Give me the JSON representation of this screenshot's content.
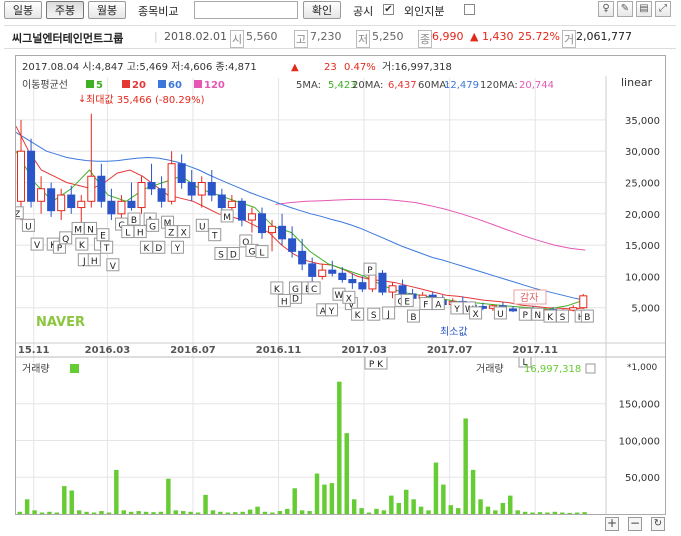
{
  "toolbar": {
    "tabs": [
      "일봉",
      "주봉",
      "월봉"
    ],
    "compare_label": "종목비교",
    "compare_value": "",
    "confirm_label": "확인",
    "disclosure_label": "공시",
    "disclosure_checked": "✔",
    "foreign_label": "외인지분"
  },
  "info": {
    "name": "씨그널엔터테인먼트그룹",
    "date": "2018.02.01",
    "open_badge": "시",
    "open": "5,560",
    "high_badge": "고",
    "high": "7,230",
    "low_badge": "저",
    "low": "5,250",
    "close_badge": "종",
    "close": "6,990",
    "change": "▲ 1,430",
    "change_pct": "25.72%",
    "volume_badge": "거",
    "volume": "2,061,777"
  },
  "chart_data": {
    "type": "candlestick",
    "interval": "weekly",
    "header": "2017.08.04 시:4,847 고:5,469 저:4,606 종:4,871 ▲ 23 0.47% 거:16,997,318",
    "header_last": "2017.08.04 시:4,847 고:5,469 저:4,606 종:4,871",
    "header_change": "▲",
    "header_change_val": "23",
    "header_change_pct": "0.47%",
    "header_volume": "거:16,997,318",
    "scale": "linear",
    "ma_legend_title": "이동평균선",
    "ma_legend": [
      {
        "period": "5",
        "color": "#3fb023"
      },
      {
        "period": "20",
        "color": "#e63737"
      },
      {
        "period": "60",
        "color": "#3c78dc"
      },
      {
        "period": "120",
        "color": "#e657b4"
      }
    ],
    "ma_values": [
      {
        "label": "5MA:",
        "value": "5,423",
        "color": "#3fb023"
      },
      {
        "label": "20MA:",
        "value": "6,437",
        "color": "#e63737"
      },
      {
        "label": "60MA:",
        "value": "12,479",
        "color": "#3c78dc"
      },
      {
        "label": "120MA:",
        "value": "20,744",
        "color": "#e657b4"
      }
    ],
    "annotation_max": "최대값 35,466 (-80.29%)",
    "annotation_min": "최소값",
    "annotation_reduction": "감자",
    "watermark": "NAVER",
    "y_ticks": [
      35000,
      30000,
      25000,
      20000,
      15000,
      10000,
      5000
    ],
    "y_tick_labels": [
      "35,000",
      "30,000",
      "25,000",
      "20,000",
      "15,000",
      "10,000",
      "5,000"
    ],
    "ylim": [
      0,
      38500
    ],
    "x_tick_labels": [
      "15.11",
      "2016.03",
      "2016.07",
      "2016.11",
      "2017.03",
      "2017.07",
      "2017.11"
    ],
    "volume_label": "거래량",
    "volume_value_label": "거래량",
    "volume_value": "16,997,318",
    "volume_multiplier": "*1,000",
    "volume_y_ticks": [
      150000,
      100000,
      50000
    ],
    "volume_y_tick_labels": [
      "150,000",
      "100,000",
      "50,000"
    ],
    "volume_ylim": [
      0,
      185000
    ],
    "ma60": [
      33000,
      32000,
      31000,
      30000,
      29500,
      29000,
      28700,
      28500,
      28400,
      28400,
      28500,
      28700,
      28900,
      29000,
      28900,
      28600,
      28200,
      27600,
      27000,
      26200,
      25500,
      24800,
      24100,
      23400,
      22800,
      22200,
      21600,
      21000,
      20500,
      20000,
      19600,
      19100,
      18700,
      18200,
      17600,
      16900,
      16200,
      15500,
      14800,
      14200,
      13600,
      13000,
      12600,
      12100,
      11600,
      11100,
      10600,
      10100,
      9600,
      9100,
      8600,
      8100,
      7700,
      7300,
      6900,
      6500,
      6200
    ],
    "ma120": [
      21500,
      21800,
      22000,
      22100,
      22200,
      22300,
      22300,
      22300,
      22100,
      21800,
      21300,
      20700,
      20000,
      19200,
      18300,
      17400,
      16500,
      15700,
      15000,
      14500,
      14200
    ],
    "ma20": [
      34000,
      30000,
      27000,
      26000,
      25000,
      24500,
      24000,
      25000,
      26500,
      27000,
      26000,
      24500,
      23000,
      22500,
      22000,
      21000,
      20000,
      19500,
      19000,
      18000,
      17000,
      15000,
      13500,
      12500,
      12000,
      11800,
      11000,
      10000,
      9500,
      9300,
      9000,
      8500,
      8000,
      7500,
      7000,
      6800,
      6500,
      6200,
      6000,
      5800,
      5400,
      5200,
      5000,
      4900,
      4800,
      5000
    ],
    "ma5": [
      30000,
      25000,
      22000,
      24000,
      27000,
      23000,
      22000,
      24000,
      25000,
      26000,
      24000,
      23000,
      22000,
      21000,
      18000,
      17000,
      14000,
      12000,
      11000,
      10000,
      8500,
      7500,
      7000,
      6500,
      6000,
      5800,
      5500,
      5200,
      5000,
      4800,
      5300,
      6300
    ],
    "candles": [
      [
        22000,
        35000,
        19000,
        30000
      ],
      [
        30000,
        32000,
        21000,
        22000
      ],
      [
        22000,
        26000,
        20000,
        24000
      ],
      [
        24000,
        25000,
        19500,
        20500
      ],
      [
        20500,
        24000,
        19000,
        23000
      ],
      [
        23000,
        24500,
        20000,
        21000
      ],
      [
        21000,
        23000,
        18500,
        22000
      ],
      [
        22000,
        36000,
        21000,
        26000
      ],
      [
        26000,
        28000,
        21000,
        22000
      ],
      [
        22000,
        24000,
        19000,
        20000
      ],
      [
        20000,
        23000,
        19000,
        22000
      ],
      [
        22000,
        25000,
        20500,
        21000
      ],
      [
        21000,
        26000,
        20000,
        25000
      ],
      [
        25000,
        28000,
        23000,
        24000
      ],
      [
        24000,
        26000,
        21000,
        22000
      ],
      [
        22000,
        30000,
        21500,
        28000
      ],
      [
        28000,
        29500,
        24000,
        25000
      ],
      [
        25000,
        27000,
        22000,
        23000
      ],
      [
        23000,
        26000,
        21000,
        25000
      ],
      [
        25000,
        27000,
        22000,
        23000
      ],
      [
        23000,
        24000,
        20000,
        21000
      ],
      [
        21000,
        23000,
        19000,
        22000
      ],
      [
        22000,
        22500,
        18000,
        19000
      ],
      [
        19000,
        21000,
        17000,
        20000
      ],
      [
        20000,
        21000,
        16000,
        17000
      ],
      [
        17000,
        19000,
        14000,
        18000
      ],
      [
        18000,
        20000,
        15000,
        16000
      ],
      [
        16000,
        18000,
        13000,
        14000
      ],
      [
        14000,
        16000,
        11000,
        12000
      ],
      [
        12000,
        13000,
        9000,
        10000
      ],
      [
        10000,
        12000,
        9500,
        11000
      ],
      [
        11000,
        12500,
        10000,
        10500
      ],
      [
        10500,
        11500,
        9000,
        9500
      ],
      [
        9500,
        10500,
        8000,
        9000
      ],
      [
        9000,
        10000,
        7500,
        8000
      ],
      [
        8000,
        11000,
        7500,
        10500
      ],
      [
        10500,
        11000,
        7000,
        7500
      ],
      [
        7500,
        9000,
        6500,
        8500
      ],
      [
        8500,
        9500,
        7000,
        7200
      ],
      [
        7200,
        8000,
        6000,
        6500
      ],
      [
        6500,
        7500,
        5500,
        7000
      ],
      [
        7000,
        7600,
        6000,
        6200
      ],
      [
        6200,
        7000,
        5200,
        5500
      ],
      [
        5500,
        6500,
        5000,
        6000
      ],
      [
        6000,
        6800,
        5300,
        5400
      ],
      [
        5400,
        6000,
        4800,
        5200
      ],
      [
        5200,
        5800,
        4600,
        4900
      ],
      [
        4900,
        5500,
        4500,
        5300
      ],
      [
        5300,
        5900,
        4700,
        4800
      ],
      [
        4800,
        5200,
        4300,
        4500
      ],
      [
        4500,
        5000,
        4000,
        4800
      ],
      [
        4800,
        5300,
        4200,
        4400
      ],
      [
        4400,
        4900,
        4000,
        4700
      ],
      [
        4700,
        5100,
        4200,
        4300
      ],
      [
        4300,
        4800,
        3900,
        4600
      ],
      [
        4600,
        5400,
        4400,
        5000
      ],
      [
        5000,
        7200,
        4800,
        6900
      ]
    ],
    "volumes": [
      3000,
      20000,
      5000,
      2000,
      3000,
      2000,
      38000,
      32000,
      5000,
      3000,
      2000,
      4000,
      2000,
      60000,
      5000,
      3000,
      4000,
      3000,
      2500,
      3000,
      48000,
      5000,
      4000,
      3000,
      2000,
      26000,
      5000,
      3000,
      2000,
      2500,
      3000,
      6000,
      10000,
      3000,
      2000,
      4000,
      7000,
      35000,
      5000,
      4000,
      55000,
      40000,
      42000,
      180000,
      110000,
      20000,
      8000,
      2000,
      7000,
      5000,
      25000,
      15000,
      33000,
      20000,
      10000,
      5000,
      70000,
      40000,
      12000,
      8000,
      130000,
      60000,
      20000,
      10000,
      5000,
      15000,
      25000,
      5000,
      3000,
      2000,
      2500,
      2000,
      3000,
      2000,
      1500,
      2000,
      2500
    ],
    "signals": [
      [
        "Z",
        0.1,
        20
      ],
      [
        "U",
        1,
        18
      ],
      [
        "V",
        1.7,
        15
      ],
      [
        "K",
        3,
        15
      ],
      [
        "P",
        3.5,
        14.5
      ],
      [
        "Q",
        4,
        16
      ],
      [
        "M",
        5,
        17.5
      ],
      [
        "N",
        6,
        17.5
      ],
      [
        "K",
        5.3,
        15
      ],
      [
        "J",
        5.5,
        12.5
      ],
      [
        "H",
        6.3,
        12.5
      ],
      [
        "I",
        6.8,
        15
      ],
      [
        "T",
        7.3,
        14.5
      ],
      [
        "V",
        7.8,
        11.7
      ],
      [
        "E",
        7,
        16.5
      ],
      [
        "C",
        8.5,
        18.2
      ],
      [
        "B",
        9.5,
        19
      ],
      [
        "H",
        10,
        17
      ],
      [
        "L",
        9,
        17
      ],
      [
        "A",
        10.8,
        19
      ],
      [
        "G",
        11,
        18
      ],
      [
        "M",
        12.2,
        18.5
      ],
      [
        "K",
        10.5,
        14.5
      ],
      [
        "D",
        11.5,
        14.5
      ],
      [
        "Z",
        12.5,
        17
      ],
      [
        "X",
        13.5,
        17
      ],
      [
        "Y",
        13,
        14.5
      ],
      [
        "U",
        15,
        18
      ],
      [
        "M",
        17,
        19.5
      ],
      [
        "T",
        16,
        16.5
      ],
      [
        "S",
        16.5,
        13.5
      ],
      [
        "D",
        17.5,
        13.5
      ],
      [
        "O",
        18.5,
        15.5
      ],
      [
        "G",
        19,
        14
      ],
      [
        "L",
        19.8,
        13.8
      ],
      [
        "K",
        21,
        8
      ],
      [
        "D",
        22.5,
        6.5
      ],
      [
        "H",
        21.6,
        6
      ],
      [
        "G",
        22.5,
        8
      ],
      [
        "E",
        23.5,
        8
      ],
      [
        "C",
        24,
        8
      ],
      [
        "A",
        24.7,
        4.5
      ],
      [
        "Y",
        25.4,
        4.5
      ],
      [
        "W",
        26,
        7
      ],
      [
        "V",
        27,
        5.5
      ],
      [
        "X",
        26.8,
        6.5
      ],
      [
        "P",
        28.5,
        11
      ],
      [
        "K",
        27.5,
        3.8
      ],
      [
        "S",
        28.8,
        3.8
      ],
      [
        "J",
        30,
        4
      ],
      [
        "G",
        31,
        6
      ],
      [
        "E",
        31.5,
        6
      ],
      [
        "B",
        32,
        3.5
      ],
      [
        "F",
        33,
        5.5
      ],
      [
        "A",
        34,
        5.5
      ],
      [
        "Y",
        35.5,
        4.8
      ],
      [
        "W",
        36.5,
        4.8
      ],
      [
        "X",
        37,
        4
      ],
      [
        "U",
        39,
        4
      ],
      [
        "P",
        41,
        3.8
      ],
      [
        "N",
        42,
        3.8
      ],
      [
        "K",
        43,
        3.5
      ],
      [
        "S",
        44,
        3.5
      ],
      [
        "H",
        45.5,
        3.5
      ],
      [
        "B",
        46,
        3.5
      ]
    ]
  }
}
